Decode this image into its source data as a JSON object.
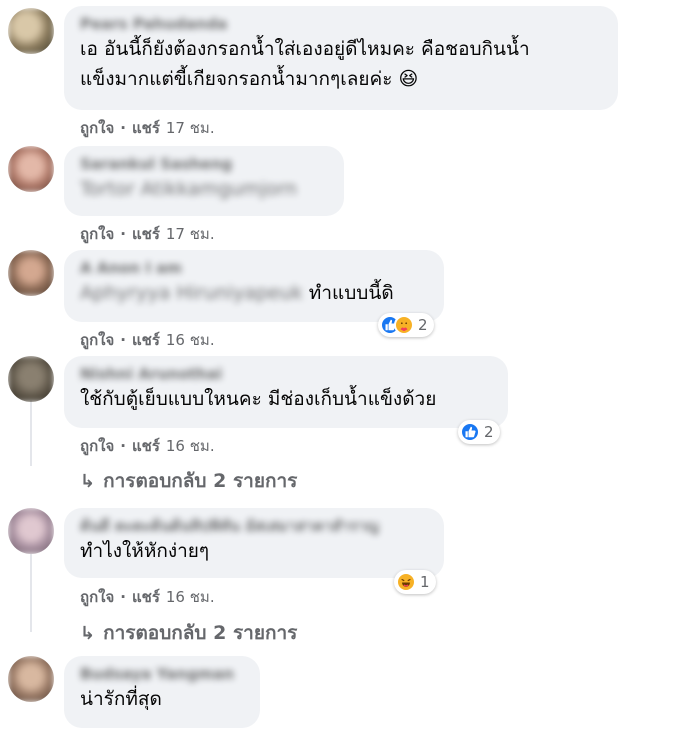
{
  "comments": [
    {
      "author": "Pears Pahudanda",
      "text": "เอ อันนี้ก็ยังต้องกรอกน้ำใส่เองอยู่ดีไหมคะ คือชอบกินน้ำ\nแข็งมากแต่ขี้เกียจกรอกน้ำมากๆเลยค่ะ 😆",
      "like": "ถูกใจ",
      "share": "แชร์",
      "time": "17 ชม."
    },
    {
      "author": "Sarankul Sasheng",
      "text_blurred": "Tortor Atikkamgumjorn",
      "like": "ถูกใจ",
      "share": "แชร์",
      "time": "17 ชม."
    },
    {
      "author": "A Anon I am",
      "text_blurred": "Aphyryya Hiruniyapeuk",
      "text": "ทำแบบนี้ดิ",
      "like": "ถูกใจ",
      "share": "แชร์",
      "time": "16 ชม.",
      "reaction_count": "2"
    },
    {
      "author": "Nishni Arunothai",
      "text": "ใช้กับตู้เย็บแบบใหนคะ มีช่องเก็บน้ำแข็งด้วย",
      "like": "ถูกใจ",
      "share": "แชร์",
      "time": "16 ชม.",
      "reaction_count": "2",
      "replies": "การตอบกลับ 2 รายการ"
    },
    {
      "author": "ต้นดี ตะตะต้นต้นทิปพิทัน อัสเสมาสาคาสำราญ",
      "text": "ทำไงให้หักง่ายๆ",
      "like": "ถูกใจ",
      "share": "แชร์",
      "time": "16 ชม.",
      "reaction_count": "1",
      "replies": "การตอบกลับ 2 รายการ"
    },
    {
      "author": "Budsaya Yangman",
      "text": "น่ารักที่สุด"
    }
  ],
  "colors": {
    "bubble": "#f0f2f5",
    "meta": "#65676b",
    "like_blue": "#1877f2",
    "haha_yellow": "#f7b125"
  },
  "icons": {
    "like": "thumbs-up-icon",
    "care": "care-hug-icon",
    "haha": "haha-icon",
    "reply": "reply-arrow-icon"
  }
}
